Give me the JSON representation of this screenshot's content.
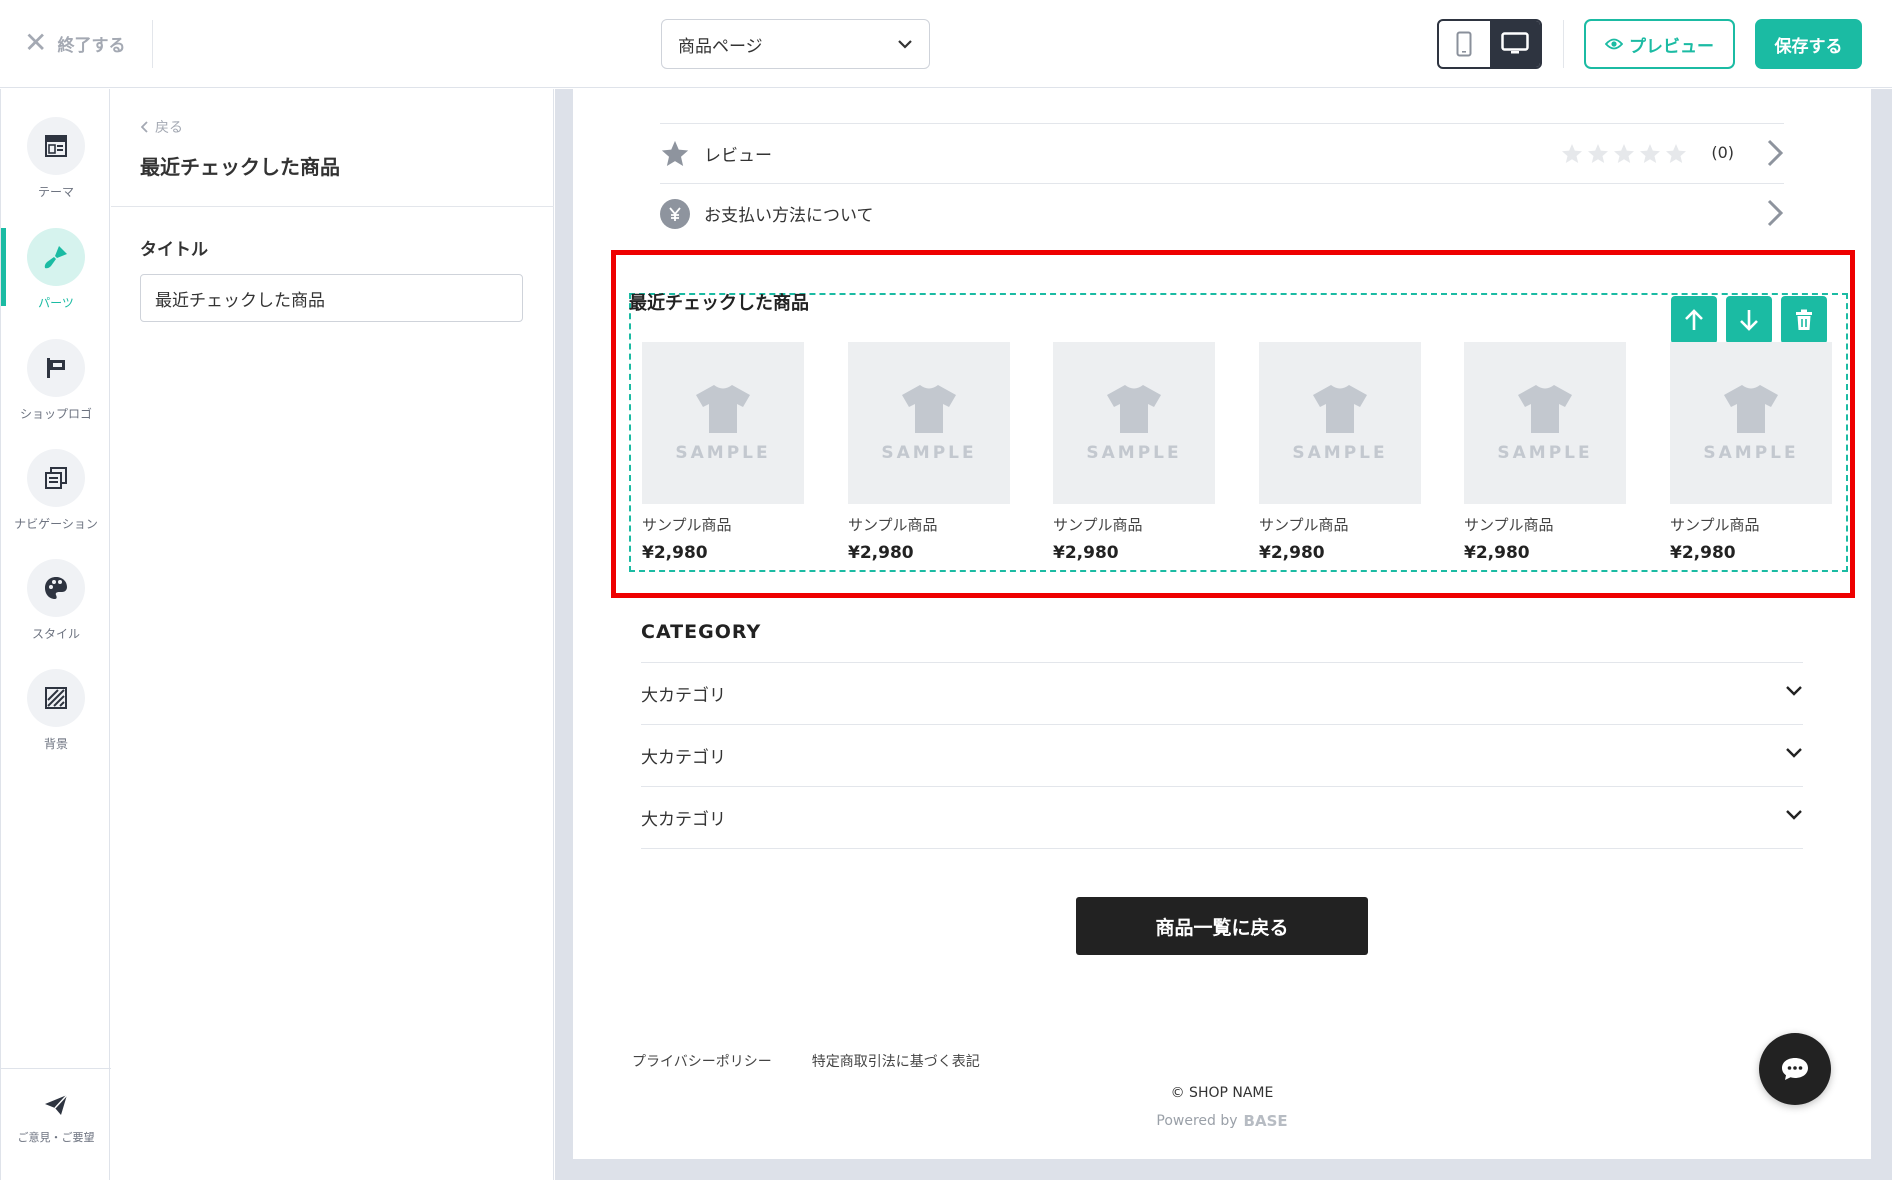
{
  "topbar": {
    "exit_label": "終了する",
    "page_select_value": "商品ページ",
    "preview_label": "プレビュー",
    "save_label": "保存する"
  },
  "rail": {
    "items": [
      {
        "label": "テーマ",
        "icon": "theme-icon"
      },
      {
        "label": "パーツ",
        "icon": "brush-icon",
        "active": true
      },
      {
        "label": "ショップロゴ",
        "icon": "flag-icon"
      },
      {
        "label": "ナビゲーション",
        "icon": "navigation-icon"
      },
      {
        "label": "スタイル",
        "icon": "palette-icon"
      },
      {
        "label": "背景",
        "icon": "background-icon"
      }
    ],
    "feedback_label": "ご意見・ご要望"
  },
  "panel": {
    "back_label": "戻る",
    "title": "最近チェックした商品",
    "field_label": "タイトル",
    "field_value": "最近チェックした商品"
  },
  "page": {
    "review_label": "レビュー",
    "review_count": "(0)",
    "payment_label": "お支払い方法について",
    "section_title": "最近チェックした商品",
    "products": [
      {
        "sample": "SAMPLE",
        "name": "サンプル商品",
        "price": "¥2,980"
      },
      {
        "sample": "SAMPLE",
        "name": "サンプル商品",
        "price": "¥2,980"
      },
      {
        "sample": "SAMPLE",
        "name": "サンプル商品",
        "price": "¥2,980"
      },
      {
        "sample": "SAMPLE",
        "name": "サンプル商品",
        "price": "¥2,980"
      },
      {
        "sample": "SAMPLE",
        "name": "サンプル商品",
        "price": "¥2,980"
      },
      {
        "sample": "SAMPLE",
        "name": "サンプル商品",
        "price": "¥2,980"
      }
    ],
    "category_title": "CATEGORY",
    "categories": [
      "大カテゴリ",
      "大カテゴリ",
      "大カテゴリ"
    ],
    "back_to_list": "商品一覧に戻る",
    "footer_links": [
      "プライバシーポリシー",
      "特定商取引法に基づく表記"
    ],
    "copyright": "© SHOP NAME",
    "powered_by": "Powered by",
    "powered_brand": "BASE"
  },
  "colors": {
    "accent": "#1bbba3",
    "highlight": "#ee0000",
    "dark": "#2e3440"
  }
}
